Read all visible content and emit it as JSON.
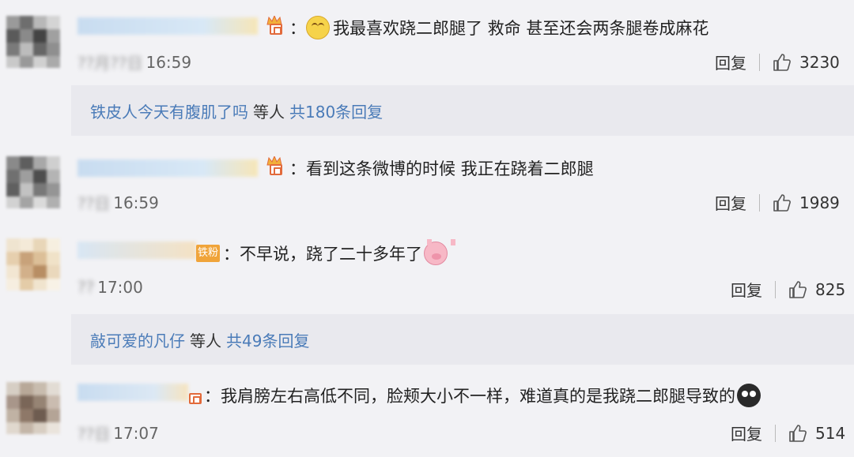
{
  "comments": [
    {
      "text": "我最喜欢跷二郎腿了 救命   甚至还会两条腿卷成麻花",
      "time_blur": "??月??日",
      "time": "16:59",
      "reply_label": "回复",
      "likes": "3230",
      "emoji": "smile-emoji"
    },
    {
      "text": "看到这条微博的时候  我正在跷着二郎腿",
      "time_blur": "??日",
      "time": "16:59",
      "reply_label": "回复",
      "likes": "1989"
    },
    {
      "fan_badge": "铁粉",
      "text": "不早说，跷了二十多年了",
      "time_blur": "??",
      "time": "17:00",
      "reply_label": "回复",
      "likes": "825",
      "emoji": "pig-emoji"
    },
    {
      "text": "我肩膀左右高低不同，脸颊大小不一样，难道真的是我跷二郎腿导致的",
      "time_blur": "??日",
      "time": "17:07",
      "reply_label": "回复",
      "likes": "514",
      "emoji": "cry-emoji"
    }
  ],
  "replies": [
    {
      "user": "铁皮人今天有腹肌了吗",
      "etc": "等人",
      "total": "共180条回复"
    },
    {
      "user": "敲可爱的凡仔",
      "etc": "等人",
      "total": "共49条回复"
    }
  ],
  "colors": {
    "link": "#4a7bb8",
    "background": "#f2f2f5",
    "reply_bg": "#e9e9ee",
    "badge": "#e26a3b",
    "fan_badge": "#f0a43a"
  }
}
